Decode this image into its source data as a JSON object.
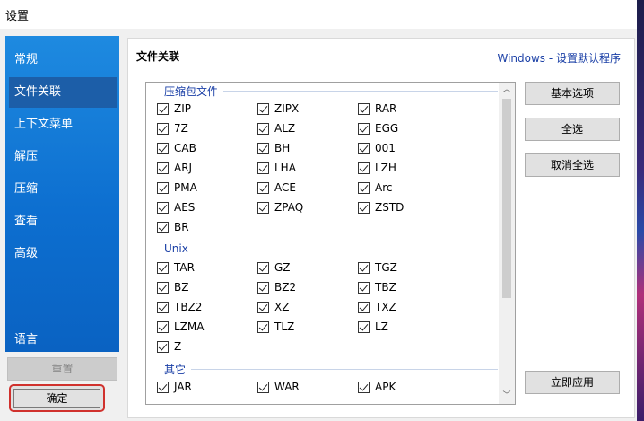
{
  "window": {
    "title": "设置"
  },
  "sidebar": {
    "items": [
      {
        "label": "常规",
        "active": false
      },
      {
        "label": "文件关联",
        "active": true
      },
      {
        "label": "上下文菜单",
        "active": false
      },
      {
        "label": "解压",
        "active": false
      },
      {
        "label": "压缩",
        "active": false
      },
      {
        "label": "查看",
        "active": false
      },
      {
        "label": "高级",
        "active": false
      }
    ],
    "language_label": "语言",
    "reset_label": "重置",
    "ok_label": "确定"
  },
  "panel": {
    "title": "文件关联",
    "link": "Windows - 设置默认程序",
    "groups": [
      {
        "name": "压缩包文件",
        "items": [
          {
            "label": "ZIP",
            "checked": true
          },
          {
            "label": "ZIPX",
            "checked": true
          },
          {
            "label": "RAR",
            "checked": true
          },
          {
            "label": "7Z",
            "checked": true
          },
          {
            "label": "ALZ",
            "checked": true
          },
          {
            "label": "EGG",
            "checked": true
          },
          {
            "label": "CAB",
            "checked": true
          },
          {
            "label": "BH",
            "checked": true
          },
          {
            "label": "001",
            "checked": true
          },
          {
            "label": "ARJ",
            "checked": true
          },
          {
            "label": "LHA",
            "checked": true
          },
          {
            "label": "LZH",
            "checked": true
          },
          {
            "label": "PMA",
            "checked": true
          },
          {
            "label": "ACE",
            "checked": true
          },
          {
            "label": "Arc",
            "checked": true
          },
          {
            "label": "AES",
            "checked": true
          },
          {
            "label": "ZPAQ",
            "checked": true
          },
          {
            "label": "ZSTD",
            "checked": true
          },
          {
            "label": "BR",
            "checked": true
          }
        ]
      },
      {
        "name": "Unix",
        "items": [
          {
            "label": "TAR",
            "checked": true
          },
          {
            "label": "GZ",
            "checked": true
          },
          {
            "label": "TGZ",
            "checked": true
          },
          {
            "label": "BZ",
            "checked": true
          },
          {
            "label": "BZ2",
            "checked": true
          },
          {
            "label": "TBZ",
            "checked": true
          },
          {
            "label": "TBZ2",
            "checked": true
          },
          {
            "label": "XZ",
            "checked": true
          },
          {
            "label": "TXZ",
            "checked": true
          },
          {
            "label": "LZMA",
            "checked": true
          },
          {
            "label": "TLZ",
            "checked": true
          },
          {
            "label": "LZ",
            "checked": true
          },
          {
            "label": "Z",
            "checked": true
          }
        ]
      },
      {
        "name": "其它",
        "items": [
          {
            "label": "JAR",
            "checked": true
          },
          {
            "label": "WAR",
            "checked": true
          },
          {
            "label": "APK",
            "checked": true
          }
        ]
      }
    ],
    "buttons": {
      "basic": "基本选项",
      "select_all": "全选",
      "deselect_all": "取消全选",
      "apply": "立即应用"
    }
  },
  "icons": {
    "scroll_up": "chevron-up-icon",
    "scroll_down": "chevron-down-icon"
  },
  "colors": {
    "sidebar_blue": "#0d6fd0",
    "accent_text": "#1a3fa6",
    "highlight_red": "#d0312d"
  }
}
